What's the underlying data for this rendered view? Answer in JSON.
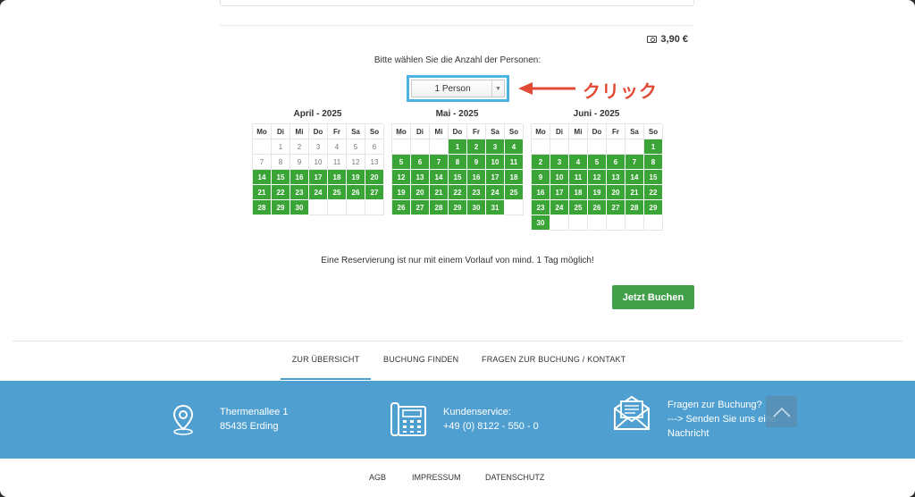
{
  "price": "3,90 €",
  "persons_prompt": "Bitte wählen Sie die Anzahl der Personen:",
  "persons_select": {
    "value": "1 Person"
  },
  "annotation": {
    "text": "クリック",
    "color": "#e14a35"
  },
  "weekdays": [
    "Mo",
    "Di",
    "Mi",
    "Do",
    "Fr",
    "Sa",
    "So"
  ],
  "calendars": [
    {
      "title": "April - 2025",
      "offset": 1,
      "days": 30,
      "available_from": 14
    },
    {
      "title": "Mai - 2025",
      "offset": 3,
      "days": 31,
      "available_from": 1
    },
    {
      "title": "Juni - 2025",
      "offset": 6,
      "days": 30,
      "available_from": 1
    }
  ],
  "notice": "Eine Reservierung ist nur mit einem Vorlauf von mind. 1 Tag möglich!",
  "book_button": "Jetzt Buchen",
  "nav": {
    "overview": "ZUR ÜBERSICHT",
    "find": "BUCHUNG FINDEN",
    "contact": "FRAGEN ZUR BUCHUNG / KONTAKT"
  },
  "footer": {
    "address_line1": "Thermenallee 1",
    "address_line2": "85435 Erding",
    "service_label": "Kundenservice:",
    "service_phone": "+49 (0) 8122 - 550 - 0",
    "question_line1": "Fragen zur Buchung?",
    "question_line2": "---> Senden Sie uns eine",
    "question_line3": "Nachricht"
  },
  "bottom_links": {
    "agb": "AGB",
    "impressum": "IMPRESSUM",
    "datenschutz": "DATENSCHUTZ"
  },
  "colors": {
    "available": "#3aa536",
    "highlight": "#4cb3e6",
    "footer": "#4fa0d0",
    "button": "#43a04a"
  }
}
